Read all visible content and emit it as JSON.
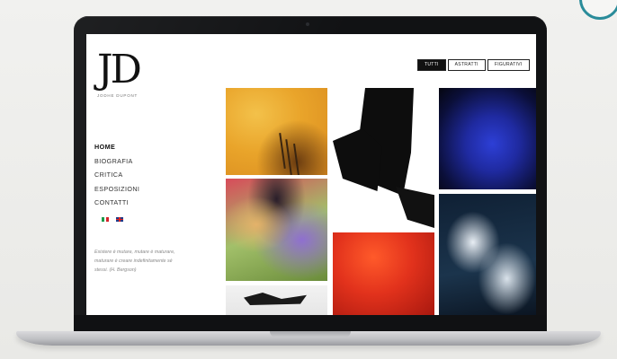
{
  "site": {
    "logo_text": "JD",
    "logo_subtitle": "JODHE DUPONT"
  },
  "nav": {
    "items": [
      {
        "label": "HOME",
        "active": true
      },
      {
        "label": "BIOGRAFIA",
        "active": false
      },
      {
        "label": "CRITICA",
        "active": false
      },
      {
        "label": "ESPOSIZIONI",
        "active": false
      },
      {
        "label": "CONTATTI",
        "active": false
      }
    ]
  },
  "languages": [
    "italian-flag-icon",
    "uk-flag-icon"
  ],
  "quote": {
    "text": "Esistere è mutare, mutare è maturare, maturare è creare indefinitamente sé stessi.",
    "author": "(H. Bergson)"
  },
  "filters": {
    "items": [
      {
        "label": "TUTTI",
        "selected": true
      },
      {
        "label": "ASTRATTI",
        "selected": false
      },
      {
        "label": "FIGURATIVI",
        "selected": false
      }
    ]
  },
  "gallery": {
    "tiles": [
      {
        "name": "artwork-yellow-abstract"
      },
      {
        "name": "artwork-black-white-ink"
      },
      {
        "name": "artwork-blue-abstract"
      },
      {
        "name": "artwork-figurative-portrait"
      },
      {
        "name": "artwork-red-abstract"
      },
      {
        "name": "artwork-dark-blue-white"
      },
      {
        "name": "artwork-white-black-strokes"
      }
    ]
  },
  "colors": {
    "page_bg": "#ececea",
    "laptop_bezel": "#111214",
    "screen_bg": "#ffffff",
    "accent_ring": "#2a8c9a",
    "filter_selected_bg": "#111111"
  }
}
